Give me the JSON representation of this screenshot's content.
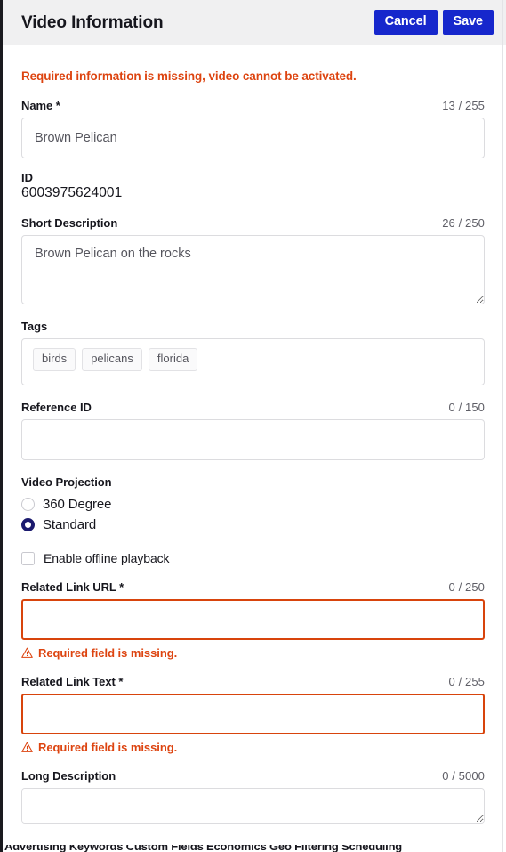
{
  "header": {
    "title": "Video Information",
    "cancel_label": "Cancel",
    "save_label": "Save",
    "button_color": "#1627cc",
    "background": "#f0f0f1"
  },
  "alert": {
    "message": "Required information is missing, video cannot be activated.",
    "color": "#dd4410"
  },
  "fields": {
    "name": {
      "label": "Name *",
      "counter": "13 / 255",
      "value": "Brown Pelican",
      "placeholder": ""
    },
    "id": {
      "label": "ID",
      "value": "6003975624001"
    },
    "short_description": {
      "label": "Short Description",
      "counter": "26 / 250",
      "value": "Brown Pelican on the rocks",
      "placeholder": ""
    },
    "tags": {
      "label": "Tags",
      "chips": [
        "birds",
        "pelicans",
        "florida"
      ]
    },
    "reference_id": {
      "label": "Reference ID",
      "counter": "0 / 150",
      "value": "",
      "placeholder": ""
    },
    "video_projection": {
      "label": "Video Projection",
      "options": [
        {
          "label": "360 Degree",
          "selected": false
        },
        {
          "label": "Standard",
          "selected": true
        }
      ],
      "selected_color": "#1b1a6e"
    },
    "offline_playback": {
      "label": "Enable offline playback",
      "checked": false
    },
    "related_link_url": {
      "label": "Related Link URL *",
      "counter": "0 / 250",
      "value": "",
      "placeholder": "",
      "error": "Required field is missing.",
      "error_color": "#d8440c"
    },
    "related_link_text": {
      "label": "Related Link Text *",
      "counter": "0 / 255",
      "value": "",
      "placeholder": "",
      "error": "Required field is missing.",
      "error_color": "#d8440c"
    },
    "long_description": {
      "label": "Long Description",
      "counter": "0 / 5000",
      "value": "",
      "placeholder": ""
    }
  },
  "clipped_bottom_row": {
    "text": "Advertising Keywords    Custom Fields    Economics    Geo Filtering    Scheduling"
  }
}
